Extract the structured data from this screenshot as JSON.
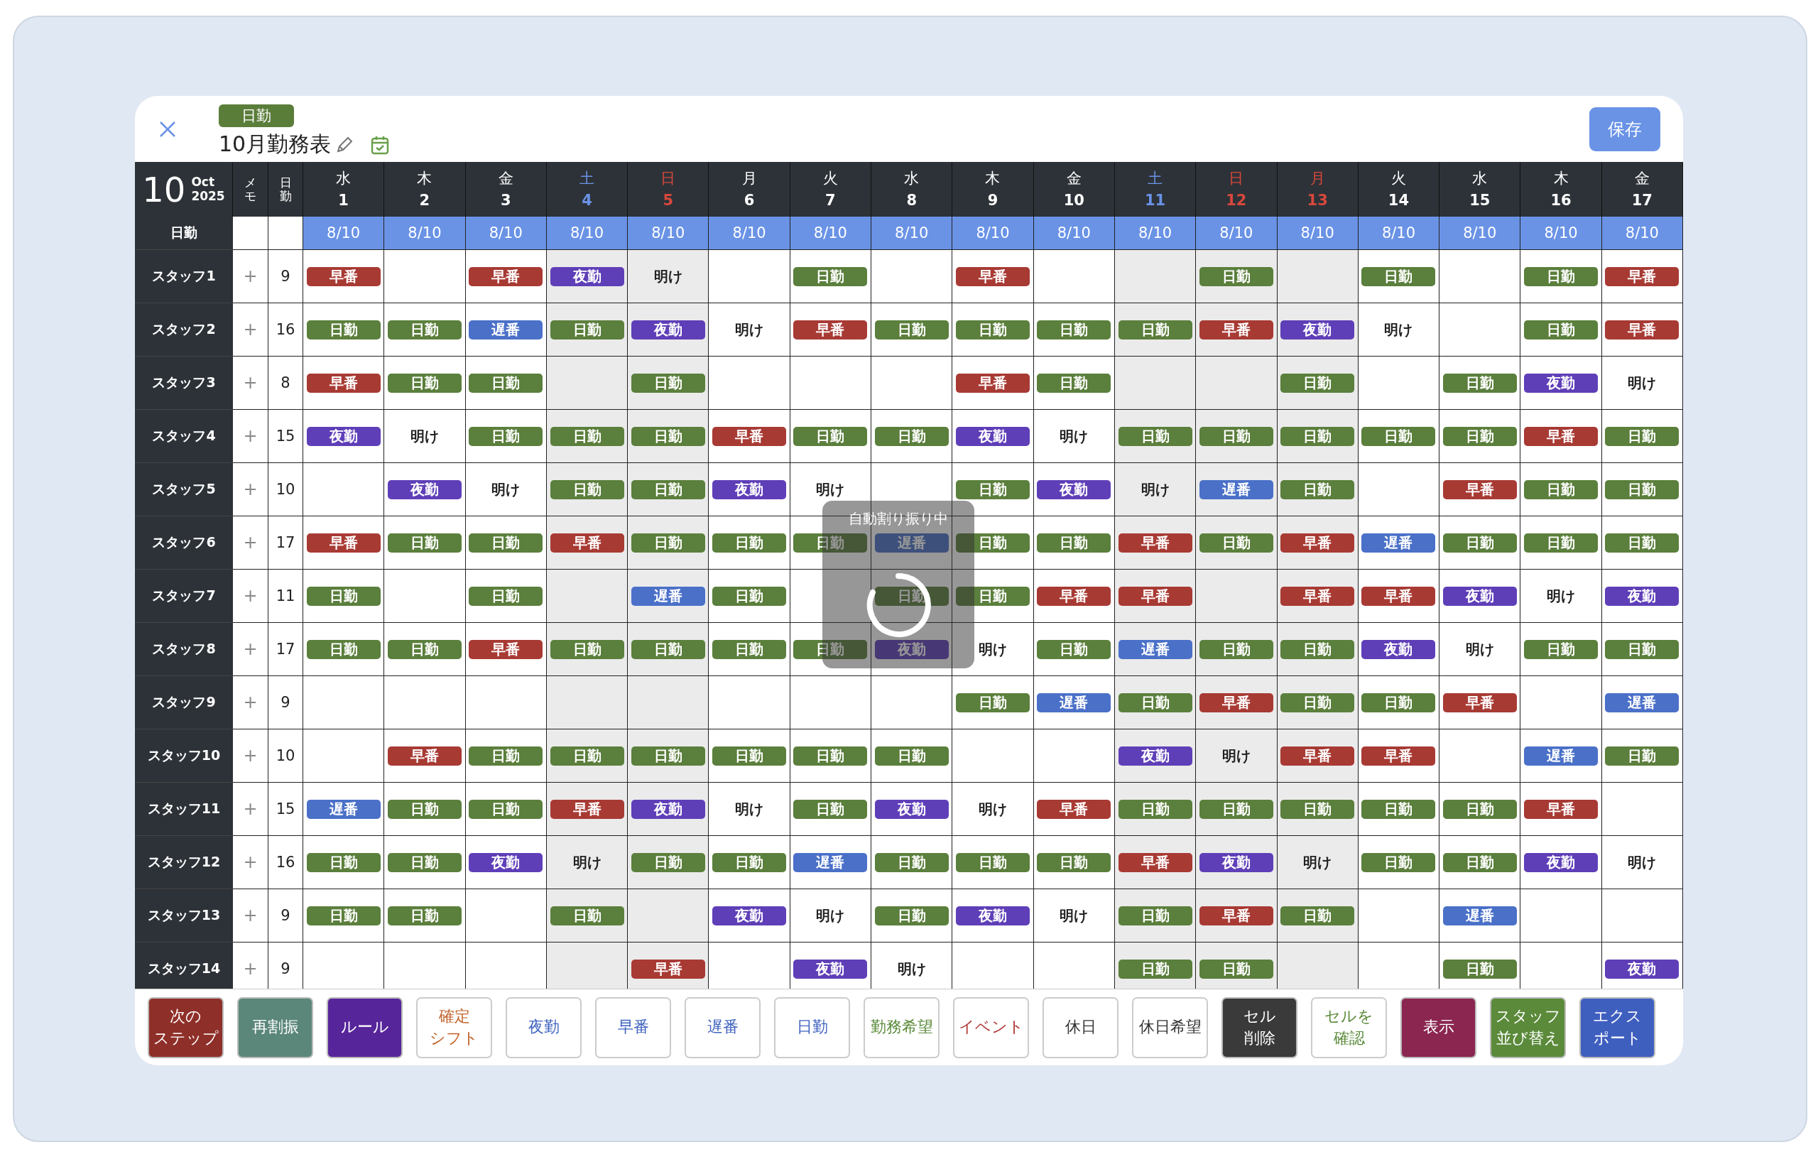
{
  "header": {
    "badge": "日勤",
    "title": "10月勤務表",
    "save_button": "保存"
  },
  "calendar": {
    "day": "10",
    "month": "Oct",
    "year": "2025"
  },
  "columns": {
    "memo": "メモ",
    "count": "日勤",
    "quota_label": "日勤"
  },
  "days": [
    {
      "weekday": "水",
      "date": "1",
      "kind": "weekday",
      "quota": "8/10"
    },
    {
      "weekday": "木",
      "date": "2",
      "kind": "weekday",
      "quota": "8/10"
    },
    {
      "weekday": "金",
      "date": "3",
      "kind": "weekday",
      "quota": "8/10"
    },
    {
      "weekday": "土",
      "date": "4",
      "kind": "saturday",
      "quota": "8/10"
    },
    {
      "weekday": "日",
      "date": "5",
      "kind": "sunday",
      "quota": "8/10"
    },
    {
      "weekday": "月",
      "date": "6",
      "kind": "weekday",
      "quota": "8/10"
    },
    {
      "weekday": "火",
      "date": "7",
      "kind": "weekday",
      "quota": "8/10"
    },
    {
      "weekday": "水",
      "date": "8",
      "kind": "weekday",
      "quota": "8/10"
    },
    {
      "weekday": "木",
      "date": "9",
      "kind": "weekday",
      "quota": "8/10"
    },
    {
      "weekday": "金",
      "date": "10",
      "kind": "weekday",
      "quota": "8/10"
    },
    {
      "weekday": "土",
      "date": "11",
      "kind": "saturday",
      "quota": "8/10"
    },
    {
      "weekday": "日",
      "date": "12",
      "kind": "sunday",
      "quota": "8/10"
    },
    {
      "weekday": "月",
      "date": "13",
      "kind": "holiday",
      "quota": "8/10"
    },
    {
      "weekday": "火",
      "date": "14",
      "kind": "weekday",
      "quota": "8/10"
    },
    {
      "weekday": "水",
      "date": "15",
      "kind": "weekday",
      "quota": "8/10"
    },
    {
      "weekday": "木",
      "date": "16",
      "kind": "weekday",
      "quota": "8/10"
    },
    {
      "weekday": "金",
      "date": "17",
      "kind": "weekday",
      "quota": "8/10"
    }
  ],
  "staff": [
    {
      "name": "スタッフ1",
      "add": "+",
      "count": "9",
      "shifts": [
        {
          "label": "早番",
          "kind": "early"
        },
        {
          "kind": "blank"
        },
        {
          "label": "早番",
          "kind": "early"
        },
        {
          "label": "夜勤",
          "kind": "night"
        },
        {
          "label": "明け",
          "kind": "after"
        },
        {
          "kind": "blank"
        },
        {
          "label": "日勤",
          "kind": "day"
        },
        {
          "kind": "blank"
        },
        {
          "label": "早番",
          "kind": "early"
        },
        {
          "kind": "blank"
        },
        {
          "kind": "blank"
        },
        {
          "label": "日勤",
          "kind": "day"
        },
        {
          "kind": "blank"
        },
        {
          "label": "日勤",
          "kind": "day"
        },
        {
          "kind": "blank"
        },
        {
          "label": "日勤",
          "kind": "day"
        },
        {
          "label": "早番",
          "kind": "early"
        }
      ]
    },
    {
      "name": "スタッフ2",
      "add": "+",
      "count": "16",
      "shifts": [
        {
          "label": "日勤",
          "kind": "day"
        },
        {
          "label": "日勤",
          "kind": "day"
        },
        {
          "label": "遅番",
          "kind": "late"
        },
        {
          "label": "日勤",
          "kind": "day"
        },
        {
          "label": "夜勤",
          "kind": "night"
        },
        {
          "label": "明け",
          "kind": "after"
        },
        {
          "label": "早番",
          "kind": "early"
        },
        {
          "label": "日勤",
          "kind": "day"
        },
        {
          "label": "日勤",
          "kind": "day"
        },
        {
          "label": "日勤",
          "kind": "day"
        },
        {
          "label": "日勤",
          "kind": "day"
        },
        {
          "label": "早番",
          "kind": "early"
        },
        {
          "label": "夜勤",
          "kind": "night"
        },
        {
          "label": "明け",
          "kind": "after"
        },
        {
          "kind": "blank"
        },
        {
          "label": "日勤",
          "kind": "day"
        },
        {
          "label": "早番",
          "kind": "early"
        }
      ]
    },
    {
      "name": "スタッフ3",
      "add": "+",
      "count": "8",
      "shifts": [
        {
          "label": "早番",
          "kind": "early"
        },
        {
          "label": "日勤",
          "kind": "day"
        },
        {
          "label": "日勤",
          "kind": "day"
        },
        {
          "kind": "blank"
        },
        {
          "label": "日勤",
          "kind": "day"
        },
        {
          "kind": "blank"
        },
        {
          "kind": "blank"
        },
        {
          "kind": "blank"
        },
        {
          "label": "早番",
          "kind": "early"
        },
        {
          "label": "日勤",
          "kind": "day"
        },
        {
          "kind": "blank"
        },
        {
          "kind": "blank"
        },
        {
          "label": "日勤",
          "kind": "day"
        },
        {
          "kind": "blank"
        },
        {
          "label": "日勤",
          "kind": "day"
        },
        {
          "label": "夜勤",
          "kind": "night"
        },
        {
          "label": "明け",
          "kind": "after"
        }
      ]
    },
    {
      "name": "スタッフ4",
      "add": "+",
      "count": "15",
      "shifts": [
        {
          "label": "夜勤",
          "kind": "night"
        },
        {
          "label": "明け",
          "kind": "after"
        },
        {
          "label": "日勤",
          "kind": "day"
        },
        {
          "label": "日勤",
          "kind": "day"
        },
        {
          "label": "日勤",
          "kind": "day"
        },
        {
          "label": "早番",
          "kind": "early"
        },
        {
          "label": "日勤",
          "kind": "day"
        },
        {
          "label": "日勤",
          "kind": "day"
        },
        {
          "label": "夜勤",
          "kind": "night"
        },
        {
          "label": "明け",
          "kind": "after"
        },
        {
          "label": "日勤",
          "kind": "day"
        },
        {
          "label": "日勤",
          "kind": "day"
        },
        {
          "label": "日勤",
          "kind": "day"
        },
        {
          "label": "日勤",
          "kind": "day"
        },
        {
          "label": "日勤",
          "kind": "day"
        },
        {
          "label": "早番",
          "kind": "early"
        },
        {
          "label": "日勤",
          "kind": "day"
        }
      ]
    },
    {
      "name": "スタッフ5",
      "add": "+",
      "count": "10",
      "shifts": [
        {
          "kind": "blank"
        },
        {
          "label": "夜勤",
          "kind": "night"
        },
        {
          "label": "明け",
          "kind": "after"
        },
        {
          "label": "日勤",
          "kind": "day"
        },
        {
          "label": "日勤",
          "kind": "day"
        },
        {
          "label": "夜勤",
          "kind": "night"
        },
        {
          "label": "明け",
          "kind": "after"
        },
        {
          "kind": "blank"
        },
        {
          "label": "日勤",
          "kind": "day"
        },
        {
          "label": "夜勤",
          "kind": "night"
        },
        {
          "label": "明け",
          "kind": "after"
        },
        {
          "label": "遅番",
          "kind": "late"
        },
        {
          "label": "日勤",
          "kind": "day"
        },
        {
          "kind": "blank"
        },
        {
          "label": "早番",
          "kind": "early"
        },
        {
          "label": "日勤",
          "kind": "day"
        },
        {
          "label": "日勤",
          "kind": "day"
        }
      ]
    },
    {
      "name": "スタッフ6",
      "add": "+",
      "count": "17",
      "shifts": [
        {
          "label": "早番",
          "kind": "early"
        },
        {
          "label": "日勤",
          "kind": "day"
        },
        {
          "label": "日勤",
          "kind": "day"
        },
        {
          "label": "早番",
          "kind": "early"
        },
        {
          "label": "日勤",
          "kind": "day"
        },
        {
          "label": "日勤",
          "kind": "day"
        },
        {
          "label": "日勤",
          "kind": "day"
        },
        {
          "label": "遅番",
          "kind": "late"
        },
        {
          "label": "日勤",
          "kind": "day"
        },
        {
          "label": "日勤",
          "kind": "day"
        },
        {
          "label": "早番",
          "kind": "early"
        },
        {
          "label": "日勤",
          "kind": "day"
        },
        {
          "label": "早番",
          "kind": "early"
        },
        {
          "label": "遅番",
          "kind": "late"
        },
        {
          "label": "日勤",
          "kind": "day"
        },
        {
          "label": "日勤",
          "kind": "day"
        },
        {
          "label": "日勤",
          "kind": "day"
        }
      ]
    },
    {
      "name": "スタッフ7",
      "add": "+",
      "count": "11",
      "shifts": [
        {
          "label": "日勤",
          "kind": "day"
        },
        {
          "kind": "blank"
        },
        {
          "label": "日勤",
          "kind": "day"
        },
        {
          "kind": "blank"
        },
        {
          "label": "遅番",
          "kind": "late"
        },
        {
          "label": "日勤",
          "kind": "day"
        },
        {
          "kind": "blank"
        },
        {
          "label": "日勤",
          "kind": "day"
        },
        {
          "label": "日勤",
          "kind": "day"
        },
        {
          "label": "早番",
          "kind": "early"
        },
        {
          "label": "早番",
          "kind": "early"
        },
        {
          "kind": "blank"
        },
        {
          "label": "早番",
          "kind": "early"
        },
        {
          "label": "早番",
          "kind": "early"
        },
        {
          "label": "夜勤",
          "kind": "night"
        },
        {
          "label": "明け",
          "kind": "after"
        },
        {
          "label": "夜勤",
          "kind": "night"
        }
      ]
    },
    {
      "name": "スタッフ8",
      "add": "+",
      "count": "17",
      "shifts": [
        {
          "label": "日勤",
          "kind": "day"
        },
        {
          "label": "日勤",
          "kind": "day"
        },
        {
          "label": "早番",
          "kind": "early"
        },
        {
          "label": "日勤",
          "kind": "day"
        },
        {
          "label": "日勤",
          "kind": "day"
        },
        {
          "label": "日勤",
          "kind": "day"
        },
        {
          "label": "日勤",
          "kind": "day"
        },
        {
          "label": "夜勤",
          "kind": "night"
        },
        {
          "label": "明け",
          "kind": "after"
        },
        {
          "label": "日勤",
          "kind": "day"
        },
        {
          "label": "遅番",
          "kind": "late"
        },
        {
          "label": "日勤",
          "kind": "day"
        },
        {
          "label": "日勤",
          "kind": "day"
        },
        {
          "label": "夜勤",
          "kind": "night"
        },
        {
          "label": "明け",
          "kind": "after"
        },
        {
          "label": "日勤",
          "kind": "day"
        },
        {
          "label": "日勤",
          "kind": "day"
        }
      ]
    },
    {
      "name": "スタッフ9",
      "add": "+",
      "count": "9",
      "shifts": [
        {
          "kind": "blank"
        },
        {
          "kind": "blank"
        },
        {
          "kind": "blank"
        },
        {
          "kind": "blank"
        },
        {
          "kind": "blank"
        },
        {
          "kind": "blank"
        },
        {
          "kind": "blank"
        },
        {
          "kind": "blank"
        },
        {
          "label": "日勤",
          "kind": "day"
        },
        {
          "label": "遅番",
          "kind": "late"
        },
        {
          "label": "日勤",
          "kind": "day"
        },
        {
          "label": "早番",
          "kind": "early"
        },
        {
          "label": "日勤",
          "kind": "day"
        },
        {
          "label": "日勤",
          "kind": "day"
        },
        {
          "label": "早番",
          "kind": "early"
        },
        {
          "kind": "blank"
        },
        {
          "label": "遅番",
          "kind": "late"
        }
      ]
    },
    {
      "name": "スタッフ10",
      "add": "+",
      "count": "10",
      "shifts": [
        {
          "kind": "blank"
        },
        {
          "label": "早番",
          "kind": "early"
        },
        {
          "label": "日勤",
          "kind": "day"
        },
        {
          "label": "日勤",
          "kind": "day"
        },
        {
          "label": "日勤",
          "kind": "day"
        },
        {
          "label": "日勤",
          "kind": "day"
        },
        {
          "label": "日勤",
          "kind": "day"
        },
        {
          "label": "日勤",
          "kind": "day"
        },
        {
          "kind": "blank"
        },
        {
          "kind": "blank"
        },
        {
          "label": "夜勤",
          "kind": "night"
        },
        {
          "label": "明け",
          "kind": "after"
        },
        {
          "label": "早番",
          "kind": "early"
        },
        {
          "label": "早番",
          "kind": "early"
        },
        {
          "kind": "blank"
        },
        {
          "label": "遅番",
          "kind": "late"
        },
        {
          "label": "日勤",
          "kind": "day"
        }
      ]
    },
    {
      "name": "スタッフ11",
      "add": "+",
      "count": "15",
      "shifts": [
        {
          "label": "遅番",
          "kind": "late"
        },
        {
          "label": "日勤",
          "kind": "day"
        },
        {
          "label": "日勤",
          "kind": "day"
        },
        {
          "label": "早番",
          "kind": "early"
        },
        {
          "label": "夜勤",
          "kind": "night"
        },
        {
          "label": "明け",
          "kind": "after"
        },
        {
          "label": "日勤",
          "kind": "day"
        },
        {
          "label": "夜勤",
          "kind": "night"
        },
        {
          "label": "明け",
          "kind": "after"
        },
        {
          "label": "早番",
          "kind": "early"
        },
        {
          "label": "日勤",
          "kind": "day"
        },
        {
          "label": "日勤",
          "kind": "day"
        },
        {
          "label": "日勤",
          "kind": "day"
        },
        {
          "label": "日勤",
          "kind": "day"
        },
        {
          "label": "日勤",
          "kind": "day"
        },
        {
          "label": "早番",
          "kind": "early"
        },
        {
          "kind": "blank"
        }
      ]
    },
    {
      "name": "スタッフ12",
      "add": "+",
      "count": "16",
      "shifts": [
        {
          "label": "日勤",
          "kind": "day"
        },
        {
          "label": "日勤",
          "kind": "day"
        },
        {
          "label": "夜勤",
          "kind": "night"
        },
        {
          "label": "明け",
          "kind": "after"
        },
        {
          "label": "日勤",
          "kind": "day"
        },
        {
          "label": "日勤",
          "kind": "day"
        },
        {
          "label": "遅番",
          "kind": "late"
        },
        {
          "label": "日勤",
          "kind": "day"
        },
        {
          "label": "日勤",
          "kind": "day"
        },
        {
          "label": "日勤",
          "kind": "day"
        },
        {
          "label": "早番",
          "kind": "early"
        },
        {
          "label": "夜勤",
          "kind": "night"
        },
        {
          "label": "明け",
          "kind": "after"
        },
        {
          "label": "日勤",
          "kind": "day"
        },
        {
          "label": "日勤",
          "kind": "day"
        },
        {
          "label": "夜勤",
          "kind": "night"
        },
        {
          "label": "明け",
          "kind": "after"
        }
      ]
    },
    {
      "name": "スタッフ13",
      "add": "+",
      "count": "9",
      "shifts": [
        {
          "label": "日勤",
          "kind": "day"
        },
        {
          "label": "日勤",
          "kind": "day"
        },
        {
          "kind": "blank"
        },
        {
          "label": "日勤",
          "kind": "day"
        },
        {
          "kind": "blank"
        },
        {
          "label": "夜勤",
          "kind": "night"
        },
        {
          "label": "明け",
          "kind": "after"
        },
        {
          "label": "日勤",
          "kind": "day"
        },
        {
          "label": "夜勤",
          "kind": "night"
        },
        {
          "label": "明け",
          "kind": "after"
        },
        {
          "label": "日勤",
          "kind": "day"
        },
        {
          "label": "早番",
          "kind": "early"
        },
        {
          "label": "日勤",
          "kind": "day"
        },
        {
          "kind": "blank"
        },
        {
          "label": "遅番",
          "kind": "late"
        },
        {
          "kind": "blank"
        },
        {
          "kind": "blank"
        }
      ]
    },
    {
      "name": "スタッフ14",
      "add": "+",
      "count": "9",
      "shifts": [
        {
          "kind": "blank"
        },
        {
          "kind": "blank"
        },
        {
          "kind": "blank"
        },
        {
          "kind": "blank"
        },
        {
          "label": "早番",
          "kind": "early"
        },
        {
          "kind": "blank"
        },
        {
          "label": "夜勤",
          "kind": "night"
        },
        {
          "label": "明け",
          "kind": "after"
        },
        {
          "kind": "blank"
        },
        {
          "kind": "blank"
        },
        {
          "label": "日勤",
          "kind": "day"
        },
        {
          "label": "日勤",
          "kind": "day"
        },
        {
          "kind": "blank"
        },
        {
          "kind": "blank"
        },
        {
          "label": "日勤",
          "kind": "day"
        },
        {
          "kind": "blank"
        },
        {
          "label": "夜勤",
          "kind": "night"
        }
      ]
    }
  ],
  "overlay": {
    "message": "自動割り振り中"
  },
  "toolbar": [
    {
      "lines": [
        "次の",
        "ステップ"
      ],
      "kind": "filled",
      "color": "#8f2f29"
    },
    {
      "lines": [
        "再割振"
      ],
      "kind": "filled",
      "color": "#5b877a"
    },
    {
      "lines": [
        "ルール"
      ],
      "kind": "filled",
      "color": "#57259a"
    },
    {
      "lines": [
        "確定",
        "シフト"
      ],
      "kind": "outline",
      "color": "#c0622a"
    },
    {
      "lines": [
        "夜勤"
      ],
      "kind": "outline",
      "color": "#3e62bf"
    },
    {
      "lines": [
        "早番"
      ],
      "kind": "outline",
      "color": "#3e62bf"
    },
    {
      "lines": [
        "遅番"
      ],
      "kind": "outline",
      "color": "#3e62bf"
    },
    {
      "lines": [
        "日勤"
      ],
      "kind": "outline",
      "color": "#3e62bf"
    },
    {
      "lines": [
        "勤務希望"
      ],
      "kind": "outline",
      "color": "#5a8a3a"
    },
    {
      "lines": [
        "イベント"
      ],
      "kind": "outline",
      "color": "#b03434"
    },
    {
      "lines": [
        "休日"
      ],
      "kind": "outline",
      "color": "#333333"
    },
    {
      "lines": [
        "休日希望"
      ],
      "kind": "outline",
      "color": "#333333"
    },
    {
      "lines": [
        "セル",
        "削除"
      ],
      "kind": "filled",
      "color": "#3a3a3a"
    },
    {
      "lines": [
        "セルを",
        "確認"
      ],
      "kind": "outline",
      "color": "#5a8a3a"
    },
    {
      "lines": [
        "表示"
      ],
      "kind": "filled",
      "color": "#8a2650"
    },
    {
      "lines": [
        "スタッフ",
        "並び替え"
      ],
      "kind": "filled",
      "color": "#5a8a3a"
    },
    {
      "lines": [
        "エクス",
        "ポート"
      ],
      "kind": "filled",
      "color": "#3f5fbf"
    }
  ]
}
